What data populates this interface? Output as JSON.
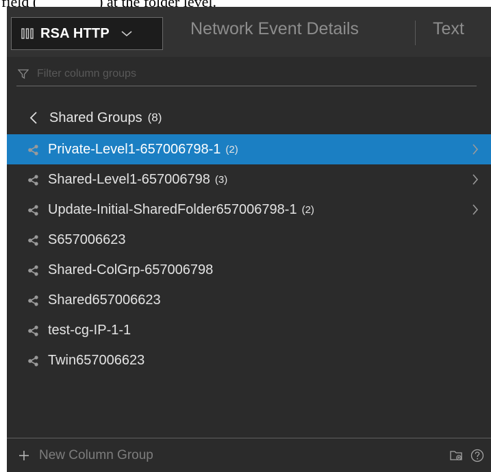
{
  "document": {
    "snippet": "field (________) at the folder level."
  },
  "tabs": {
    "dropdown_label": "RSA HTTP",
    "network": "Network Event Details",
    "text": "Text"
  },
  "filter": {
    "placeholder": "Filter column groups"
  },
  "group": {
    "title": "Shared Groups",
    "count": "(8)"
  },
  "items": [
    {
      "name": "Private-Level1-657006798-1",
      "count": "(2)",
      "selected": true,
      "has_children": true
    },
    {
      "name": "Shared-Level1-657006798",
      "count": "(3)",
      "selected": false,
      "has_children": true
    },
    {
      "name": "Update-Initial-SharedFolder657006798-1",
      "count": "(2)",
      "selected": false,
      "has_children": true
    },
    {
      "name": "S657006623",
      "count": "",
      "selected": false,
      "has_children": false
    },
    {
      "name": "Shared-ColGrp-657006798",
      "count": "",
      "selected": false,
      "has_children": false
    },
    {
      "name": "Shared657006623",
      "count": "",
      "selected": false,
      "has_children": false
    },
    {
      "name": "test-cg-IP-1-1",
      "count": "",
      "selected": false,
      "has_children": false
    },
    {
      "name": "Twin657006623",
      "count": "",
      "selected": false,
      "has_children": false
    }
  ],
  "footer": {
    "new_label": "New Column Group"
  },
  "icons": {
    "columns": "columns-icon",
    "chevron_down": "chevron-down-icon",
    "filter": "filter-icon",
    "back": "chevron-left-icon",
    "share": "share-icon",
    "chevron_right": "chevron-right-icon",
    "plus": "plus-icon",
    "folder": "folder-add-icon",
    "help": "help-icon"
  },
  "colors": {
    "panel_bg": "#2b2b2b",
    "selected_bg": "#1b7fc3",
    "tab_bar_bg": "#323232"
  }
}
